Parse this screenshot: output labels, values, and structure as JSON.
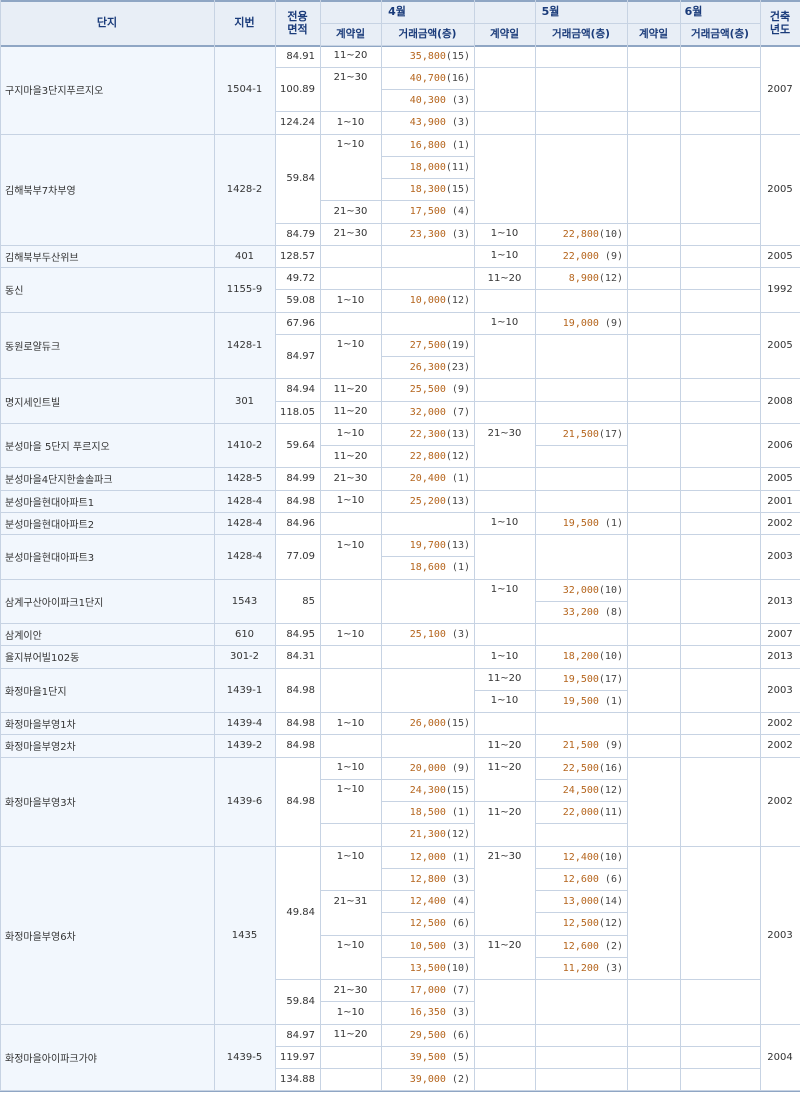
{
  "header": {
    "complex": "단지",
    "lot": "지번",
    "area": "전용\n면적",
    "year": "건축\n년도",
    "months": [
      "4월",
      "5월",
      "6월"
    ],
    "contract_day": "계약일",
    "price": "거래금액(층)"
  },
  "rows": [
    {
      "name": "구지마을3단지푸르지오",
      "lot": "1504-1",
      "year": "2007"
    },
    {
      "name": "김해북부7차부영",
      "lot": "1428-2",
      "year": "2005"
    },
    {
      "name": "김해북부두산위브",
      "lot": "401",
      "year": "2005"
    },
    {
      "name": "동신",
      "lot": "1155-9",
      "year": "1992"
    },
    {
      "name": "동원로얄듀크",
      "lot": "1428-1",
      "year": "2005"
    },
    {
      "name": "명지세인트빌",
      "lot": "301",
      "year": "2008"
    },
    {
      "name": "분성마을 5단지 푸르지오",
      "lot": "1410-2",
      "year": "2006"
    },
    {
      "name": "분성마을4단지한솔솔파크",
      "lot": "1428-5",
      "year": "2005"
    },
    {
      "name": "분성마을현대아파트1",
      "lot": "1428-4",
      "year": "2001"
    },
    {
      "name": "분성마을현대아파트2",
      "lot": "1428-4",
      "year": "2002"
    },
    {
      "name": "분성마을현대아파트3",
      "lot": "1428-4",
      "year": "2003"
    },
    {
      "name": "삼계구산아이파크1단지",
      "lot": "1543",
      "year": "2013"
    },
    {
      "name": "삼계이안",
      "lot": "610",
      "year": "2007"
    },
    {
      "name": "율지뷰어빌102동",
      "lot": "301-2",
      "year": "2013"
    },
    {
      "name": "화정마을1단지",
      "lot": "1439-1",
      "year": "2003"
    },
    {
      "name": "화정마을부영1차",
      "lot": "1439-4",
      "year": "2002"
    },
    {
      "name": "화정마을부영2차",
      "lot": "1439-2",
      "year": "2002"
    },
    {
      "name": "화정마을부영3차",
      "lot": "1439-6",
      "year": "2002"
    },
    {
      "name": "화정마을부영6차",
      "lot": "1435",
      "year": "2003"
    },
    {
      "name": "화정마을아이파크가야",
      "lot": "1439-5",
      "year": "2004"
    }
  ],
  "areas": [
    "84.91",
    "100.89",
    "124.24",
    "59.84",
    "84.79",
    "128.57",
    "49.72",
    "59.08",
    "67.96",
    "84.97",
    "84.94",
    "118.05",
    "59.64",
    "84.99",
    "84.98",
    "84.96",
    "77.09",
    "85",
    "84.95",
    "84.31",
    "84.98",
    "84.98",
    "84.98",
    "84.98",
    "49.84",
    "59.84",
    "84.97",
    "119.97",
    "134.88"
  ],
  "dates": [
    "11~20",
    "21~30",
    "1~10",
    "1~10",
    "21~30",
    "21~30",
    "1~10",
    "1~10",
    "11~20",
    "1~10",
    "1~10",
    "1~10",
    "11~20",
    "11~20",
    "1~10",
    "21~30",
    "11~20",
    "21~30",
    "1~10",
    "1~10",
    "1~10",
    "1~10",
    "1~10",
    "1~10",
    "11~20",
    "1~10",
    "1~10",
    "11~20",
    "1~10",
    "11~20",
    "1~10",
    "11~20",
    "1~10",
    "21~30",
    "21~31",
    "1~10",
    "11~20",
    "21~30",
    "1~10",
    "11~20"
  ],
  "prices": [
    {
      "amt": "35,800",
      "cnt": "(15)"
    },
    {
      "amt": "40,700",
      "cnt": "(16)"
    },
    {
      "amt": "40,300",
      "cnt": "(3)"
    },
    {
      "amt": "43,900",
      "cnt": "(3)"
    },
    {
      "amt": "16,800",
      "cnt": "(1)"
    },
    {
      "amt": "18,000",
      "cnt": "(11)"
    },
    {
      "amt": "18,300",
      "cnt": "(15)"
    },
    {
      "amt": "17,500",
      "cnt": "(4)"
    },
    {
      "amt": "23,300",
      "cnt": "(3)"
    },
    {
      "amt": "22,800",
      "cnt": "(10)"
    },
    {
      "amt": "22,000",
      "cnt": "(9)"
    },
    {
      "amt": "8,900",
      "cnt": "(12)"
    },
    {
      "amt": "10,000",
      "cnt": "(12)"
    },
    {
      "amt": "19,000",
      "cnt": "(9)"
    },
    {
      "amt": "27,500",
      "cnt": "(19)"
    },
    {
      "amt": "26,300",
      "cnt": "(23)"
    },
    {
      "amt": "25,500",
      "cnt": "(9)"
    },
    {
      "amt": "32,000",
      "cnt": "(7)"
    },
    {
      "amt": "22,300",
      "cnt": "(13)"
    },
    {
      "amt": "21,500",
      "cnt": "(17)"
    },
    {
      "amt": "22,800",
      "cnt": "(12)"
    },
    {
      "amt": "20,400",
      "cnt": "(1)"
    },
    {
      "amt": "25,200",
      "cnt": "(13)"
    },
    {
      "amt": "19,500",
      "cnt": "(1)"
    },
    {
      "amt": "19,700",
      "cnt": "(13)"
    },
    {
      "amt": "18,600",
      "cnt": "(1)"
    },
    {
      "amt": "32,000",
      "cnt": "(10)"
    },
    {
      "amt": "33,200",
      "cnt": "(8)"
    },
    {
      "amt": "25,100",
      "cnt": "(3)"
    },
    {
      "amt": "18,200",
      "cnt": "(10)"
    },
    {
      "amt": "19,500",
      "cnt": "(17)"
    },
    {
      "amt": "19,500",
      "cnt": "(1)"
    },
    {
      "amt": "26,000",
      "cnt": "(15)"
    },
    {
      "amt": "21,500",
      "cnt": "(9)"
    },
    {
      "amt": "20,000",
      "cnt": "(9)"
    },
    {
      "amt": "22,500",
      "cnt": "(16)"
    },
    {
      "amt": "24,300",
      "cnt": "(15)"
    },
    {
      "amt": "24,500",
      "cnt": "(12)"
    },
    {
      "amt": "18,500",
      "cnt": "(1)"
    },
    {
      "amt": "22,000",
      "cnt": "(11)"
    },
    {
      "amt": "21,300",
      "cnt": "(12)"
    },
    {
      "amt": "12,000",
      "cnt": "(1)"
    },
    {
      "amt": "12,400",
      "cnt": "(10)"
    },
    {
      "amt": "12,800",
      "cnt": "(3)"
    },
    {
      "amt": "12,600",
      "cnt": "(6)"
    },
    {
      "amt": "12,400",
      "cnt": "(4)"
    },
    {
      "amt": "13,000",
      "cnt": "(14)"
    },
    {
      "amt": "12,500",
      "cnt": "(6)"
    },
    {
      "amt": "12,500",
      "cnt": "(12)"
    },
    {
      "amt": "10,500",
      "cnt": "(3)"
    },
    {
      "amt": "12,600",
      "cnt": "(2)"
    },
    {
      "amt": "13,500",
      "cnt": "(10)"
    },
    {
      "amt": "11,200",
      "cnt": "(3)"
    },
    {
      "amt": "17,000",
      "cnt": "(7)"
    },
    {
      "amt": "16,350",
      "cnt": "(3)"
    },
    {
      "amt": "29,500",
      "cnt": "(6)"
    },
    {
      "amt": "39,500",
      "cnt": "(5)"
    },
    {
      "amt": "39,000",
      "cnt": "(2)"
    }
  ]
}
